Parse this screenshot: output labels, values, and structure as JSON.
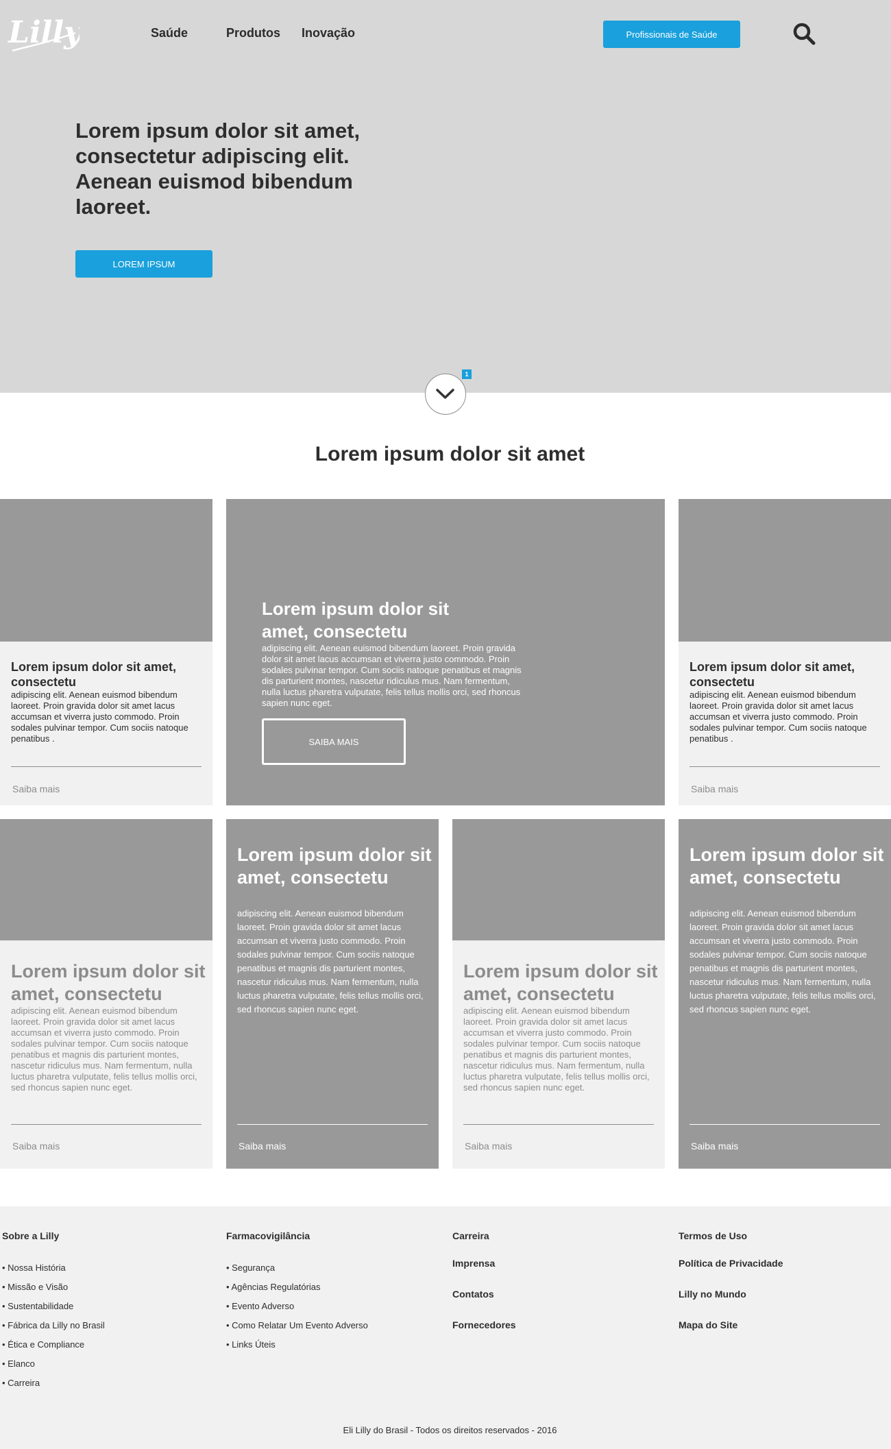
{
  "header": {
    "logo_text": "Lilly",
    "nav": [
      "Saúde",
      "Produtos",
      "Inovação"
    ],
    "pro_button": "Profissionais de Saúde"
  },
  "hero": {
    "title": "Lorem ipsum dolor sit amet, consectetur adipiscing elit. Aenean euismod bibendum laoreet.",
    "button": "LOREM IPSUM",
    "badge": "1",
    "bg_color": "#d7d7d7",
    "accent_color": "#1aa0dc"
  },
  "section": {
    "title": "Lorem ipsum dolor sit amet"
  },
  "cards": {
    "c1": {
      "title": "Lorem ipsum dolor sit amet, consectetu",
      "body": "adipiscing elit. Aenean euismod bibendum laoreet. Proin gravida dolor sit amet lacus accumsan et viverra justo commodo. Proin sodales pulvinar tempor. Cum sociis natoque penatibus .",
      "more": "Saiba mais"
    },
    "feature": {
      "title": "Lorem ipsum dolor sit amet, consectetu",
      "body": "adipiscing elit. Aenean euismod bibendum laoreet. Proin gravida dolor sit amet lacus accumsan et viverra justo commodo. Proin sodales pulvinar tempor. Cum sociis natoque penatibus et magnis dis parturient montes, nascetur ridiculus mus. Nam fermentum, nulla luctus pharetra vulputate, felis tellus mollis orci, sed rhoncus sapien nunc eget.",
      "button": "SAIBA MAIS"
    },
    "c3": {
      "title": "Lorem ipsum dolor sit amet, consectetu",
      "body": "adipiscing elit. Aenean euismod bibendum laoreet. Proin gravida dolor sit amet lacus accumsan et viverra justo commodo. Proin sodales pulvinar tempor. Cum sociis natoque penatibus .",
      "more": "Saiba mais"
    },
    "r2c1": {
      "title": "Lorem ipsum dolor sit amet, consectetu",
      "body": "adipiscing elit. Aenean euismod bibendum laoreet. Proin gravida dolor sit amet lacus accumsan et viverra justo commodo. Proin sodales pulvinar tempor. Cum sociis natoque penatibus et magnis dis parturient montes, nascetur ridiculus mus. Nam fermentum, nulla luctus pharetra vulputate, felis tellus mollis orci, sed rhoncus sapien nunc eget.",
      "more": "Saiba mais"
    },
    "r2c2": {
      "title": "Lorem ipsum dolor sit amet, consectetu",
      "body": "adipiscing elit. Aenean euismod bibendum laoreet. Proin gravida dolor sit amet lacus accumsan et viverra justo commodo. Proin sodales pulvinar tempor. Cum sociis natoque penatibus et magnis dis parturient montes, nascetur ridiculus mus. Nam fermentum, nulla luctus pharetra vulputate, felis tellus mollis orci, sed rhoncus sapien nunc eget.",
      "more": "Saiba mais"
    },
    "r2c3": {
      "title": "Lorem ipsum dolor sit amet, consectetu",
      "body": "adipiscing elit. Aenean euismod bibendum laoreet. Proin gravida dolor sit amet lacus accumsan et viverra justo commodo. Proin sodales pulvinar tempor. Cum sociis natoque penatibus et magnis dis parturient montes, nascetur ridiculus mus. Nam fermentum, nulla luctus pharetra vulputate, felis tellus mollis orci, sed rhoncus sapien nunc eget.",
      "more": "Saiba mais"
    },
    "r2c4": {
      "title": "Lorem ipsum dolor sit amet, consectetu",
      "body": "adipiscing elit. Aenean euismod bibendum laoreet. Proin gravida dolor sit amet lacus accumsan et viverra justo commodo. Proin sodales pulvinar tempor. Cum sociis natoque penatibus et magnis dis parturient montes, nascetur ridiculus mus. Nam fermentum, nulla luctus pharetra vulputate, felis tellus mollis orci, sed rhoncus sapien nunc eget.",
      "more": "Saiba mais"
    }
  },
  "footer": {
    "col1": {
      "heading": "Sobre a Lilly",
      "links": [
        "• Nossa História",
        "• Missão e Visão",
        "• Sustentabilidade",
        "• Fábrica da Lilly no Brasil",
        "• Ética e Compliance",
        "• Elanco",
        "• Carreira"
      ]
    },
    "col2": {
      "heading": "Farmacovigilância",
      "links": [
        "• Segurança",
        "• Agências Regulatórias",
        "• Evento Adverso",
        "• Como Relatar Um Evento Adverso",
        "• Links Úteis"
      ]
    },
    "col3": [
      "Carreira",
      "Imprensa",
      "Contatos",
      "Fornecedores"
    ],
    "col4": [
      "Termos de Uso",
      "Política de Privacidade",
      "Lilly no Mundo",
      "Mapa do Site"
    ],
    "copyright": "Eli Lilly do Brasil - Todos os direitos reservados - 2016"
  }
}
